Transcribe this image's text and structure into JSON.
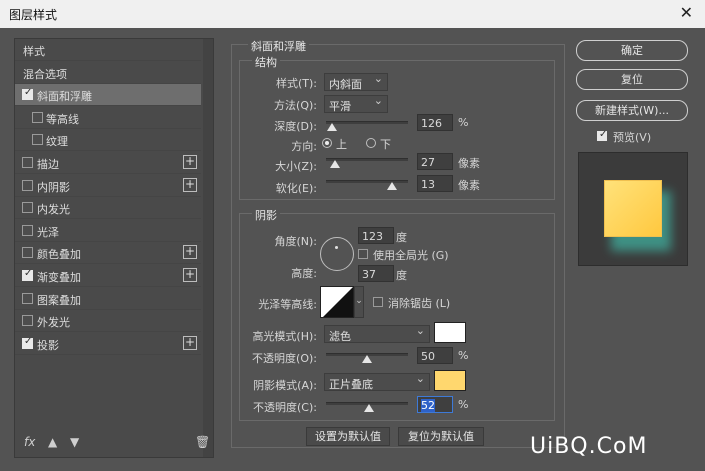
{
  "window": {
    "title": "图层样式",
    "close_icon": "close-icon"
  },
  "sidebar": {
    "items": [
      {
        "label": "样式",
        "checkbox": false,
        "checked": false,
        "plus": false,
        "sub": false,
        "selected": false
      },
      {
        "label": "混合选项",
        "checkbox": false,
        "checked": false,
        "plus": false,
        "sub": false,
        "selected": false
      },
      {
        "label": "斜面和浮雕",
        "checkbox": true,
        "checked": true,
        "plus": false,
        "sub": false,
        "selected": true
      },
      {
        "label": "等高线",
        "checkbox": true,
        "checked": false,
        "plus": false,
        "sub": true,
        "selected": false
      },
      {
        "label": "纹理",
        "checkbox": true,
        "checked": false,
        "plus": false,
        "sub": true,
        "selected": false
      },
      {
        "label": "描边",
        "checkbox": true,
        "checked": false,
        "plus": true,
        "sub": false,
        "selected": false
      },
      {
        "label": "内阴影",
        "checkbox": true,
        "checked": false,
        "plus": true,
        "sub": false,
        "selected": false
      },
      {
        "label": "内发光",
        "checkbox": true,
        "checked": false,
        "plus": false,
        "sub": false,
        "selected": false
      },
      {
        "label": "光泽",
        "checkbox": true,
        "checked": false,
        "plus": false,
        "sub": false,
        "selected": false
      },
      {
        "label": "颜色叠加",
        "checkbox": true,
        "checked": false,
        "plus": true,
        "sub": false,
        "selected": false
      },
      {
        "label": "渐变叠加",
        "checkbox": true,
        "checked": true,
        "plus": true,
        "sub": false,
        "selected": false
      },
      {
        "label": "图案叠加",
        "checkbox": true,
        "checked": false,
        "plus": false,
        "sub": false,
        "selected": false
      },
      {
        "label": "外发光",
        "checkbox": true,
        "checked": false,
        "plus": false,
        "sub": false,
        "selected": false
      },
      {
        "label": "投影",
        "checkbox": true,
        "checked": true,
        "plus": true,
        "sub": false,
        "selected": false
      }
    ],
    "footer": {
      "fx": "fx",
      "up_icon": "arrow-up-icon",
      "down_icon": "arrow-down-icon",
      "trash_icon": "trash-icon"
    }
  },
  "bevel": {
    "section_title": "斜面和浮雕",
    "structure": {
      "title": "结构",
      "style_label": "样式(T):",
      "style_value": "内斜面",
      "technique_label": "方法(Q):",
      "technique_value": "平滑",
      "depth_label": "深度(D):",
      "depth_value": "126",
      "depth_unit": "%",
      "depth_level": 0.07,
      "direction_label": "方向:",
      "dir_up": "上",
      "dir_down": "下",
      "direction_selected": "up",
      "size_label": "大小(Z):",
      "size_value": "27",
      "size_unit": "像素",
      "size_level": 0.11,
      "soften_label": "软化(E):",
      "soften_value": "13",
      "soften_unit": "像素",
      "soften_level": 0.8
    },
    "shading": {
      "title": "阴影",
      "angle_label": "角度(N):",
      "angle_value": "123",
      "angle_unit": "度",
      "global_light_label": "使用全局光 (G)",
      "altitude_label": "高度:",
      "altitude_value": "37",
      "altitude_unit": "度",
      "gloss_label": "光泽等高线:",
      "antialias_label": "消除锯齿 (L)",
      "highlight_label": "高光模式(H):",
      "highlight_mode": "滤色",
      "highlight_color": "#ffffff",
      "hl_opacity_label": "不透明度(O):",
      "hl_opacity_value": "50",
      "hl_opacity_unit": "%",
      "hl_opacity_level": 0.5,
      "shadow_label": "阴影模式(A):",
      "shadow_mode": "正片叠底",
      "shadow_color": "#ffd76e",
      "sh_opacity_label": "不透明度(C):",
      "sh_opacity_value": "52",
      "sh_opacity_unit": "%",
      "sh_opacity_level": 0.52
    },
    "set_default": "设置为默认值",
    "reset_default": "复位为默认值"
  },
  "actions": {
    "ok": "确定",
    "reset": "复位",
    "new_style": "新建样式(W)...",
    "preview_label": "预览(V)",
    "preview_checked": true
  },
  "watermark": "UiBQ.CoM"
}
